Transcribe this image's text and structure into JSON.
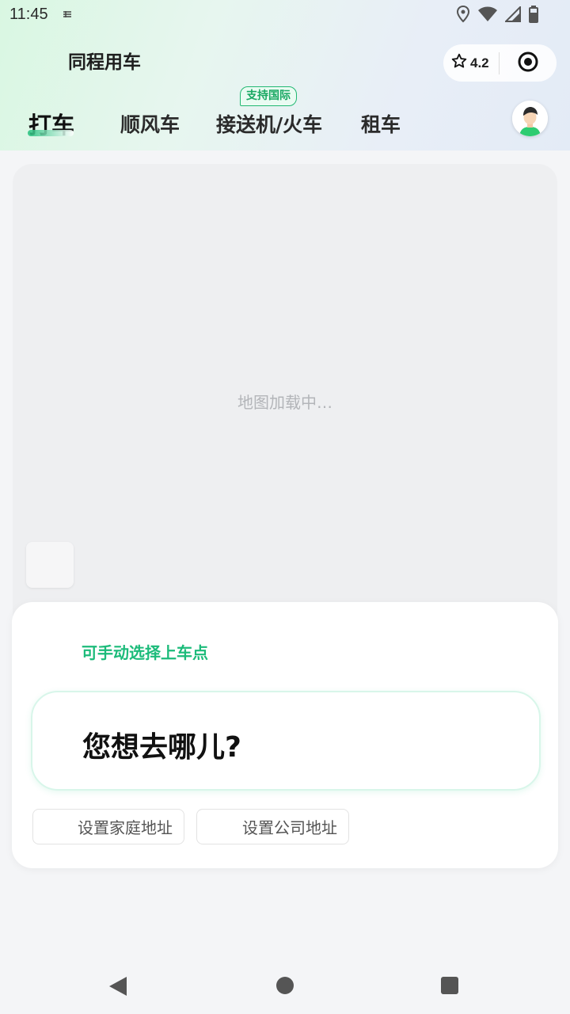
{
  "status_bar": {
    "time": "11:45"
  },
  "app": {
    "title": "同程用车",
    "rating": "4.2"
  },
  "tabs": [
    {
      "label": "打车",
      "active": true
    },
    {
      "label": "顺风车",
      "active": false
    },
    {
      "label": "接送机/火车",
      "active": false,
      "badge": "支持国际"
    },
    {
      "label": "租车",
      "active": false
    }
  ],
  "map": {
    "loading_text": "地图加载中…"
  },
  "destination": {
    "pickup_hint": "可手动选择上车点",
    "prompt": "您想去哪儿?",
    "home_button": "设置家庭地址",
    "work_button": "设置公司地址"
  },
  "colors": {
    "accent": "#1cbb7a",
    "map_bg": "#eeeff1"
  }
}
